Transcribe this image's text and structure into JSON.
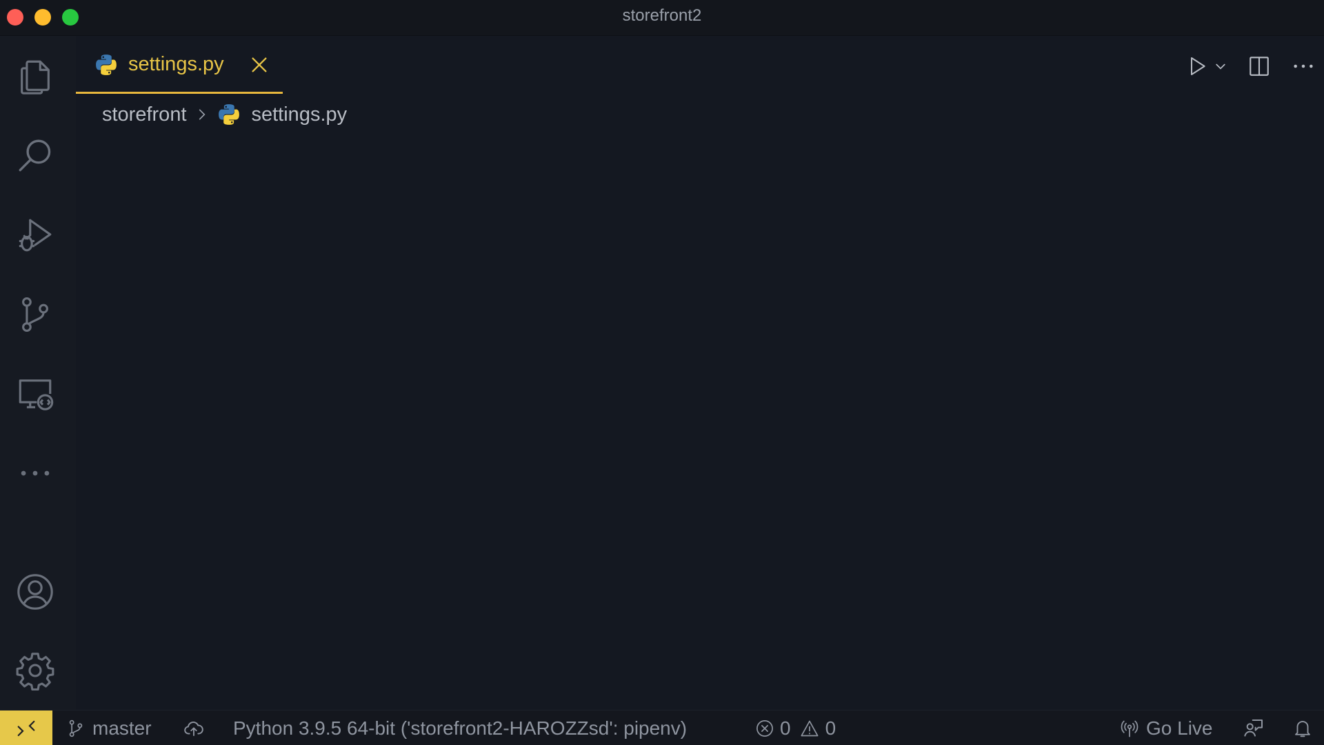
{
  "window": {
    "title": "storefront2"
  },
  "activity_bar": {
    "items": [
      {
        "icon": "explorer-icon"
      },
      {
        "icon": "search-icon"
      },
      {
        "icon": "run-debug-icon"
      },
      {
        "icon": "source-control-icon"
      },
      {
        "icon": "remote-explorer-icon"
      },
      {
        "icon": "more-icon"
      }
    ],
    "bottom": [
      {
        "icon": "account-icon"
      },
      {
        "icon": "settings-gear-icon"
      }
    ]
  },
  "editor": {
    "tab": {
      "label": "settings.py",
      "label_color": "#e8c547",
      "active_border": "#e8b73d"
    },
    "breadcrumb": {
      "folder": "storefront",
      "file": "settings.py"
    }
  },
  "status_bar": {
    "branch": "master",
    "interpreter": "Python 3.9.5 64-bit ('storefront2-HAROZZsd': pipenv)",
    "errors": "0",
    "warnings": "0",
    "go_live": "Go Live",
    "remote_color": "#e6c84a"
  }
}
